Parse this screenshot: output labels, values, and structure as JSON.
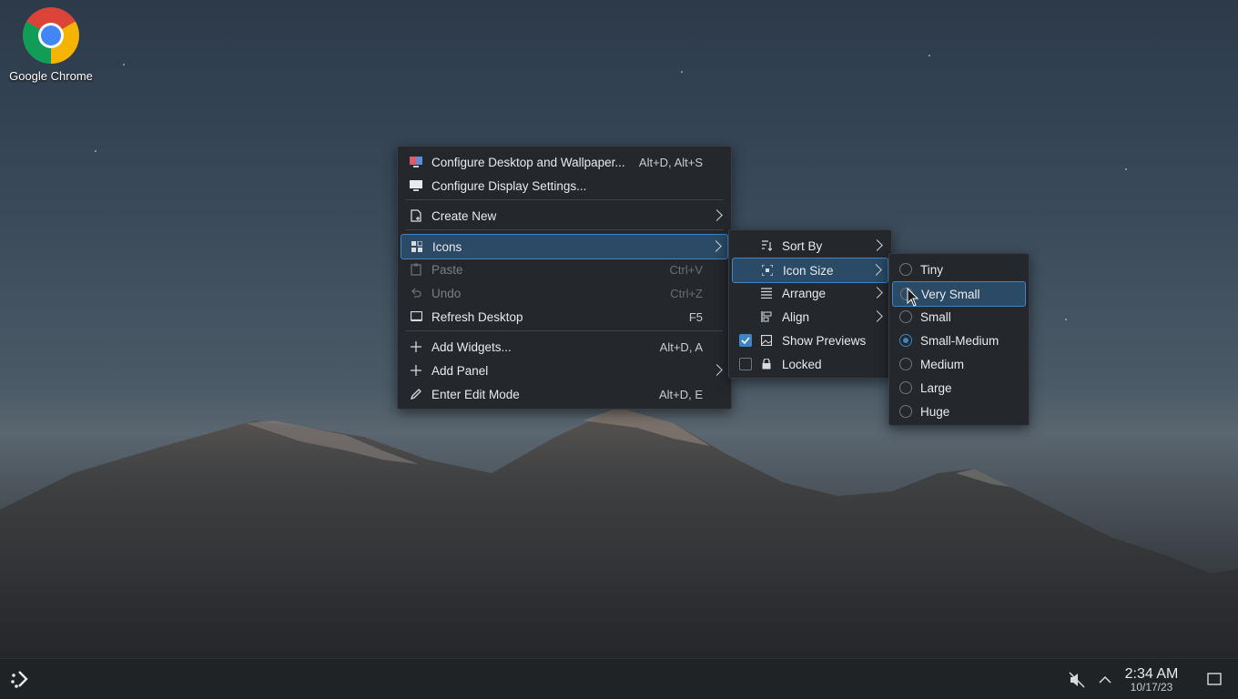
{
  "desktop": {
    "icons": [
      {
        "label": "Google Chrome",
        "icon": "chrome-icon"
      }
    ]
  },
  "main_menu": {
    "items": [
      {
        "label": "Configure Desktop and Wallpaper...",
        "shortcut": "Alt+D, Alt+S",
        "icon": "desktop-config-icon"
      },
      {
        "label": "Configure Display Settings...",
        "shortcut": "",
        "icon": "display-icon"
      },
      {
        "label": "Create New",
        "icon": "new-file-icon",
        "submenu": true
      },
      {
        "label": "Icons",
        "icon": "icons-grid-icon",
        "submenu": true,
        "highlighted": true
      },
      {
        "label": "Paste",
        "shortcut": "Ctrl+V",
        "icon": "paste-icon",
        "disabled": true
      },
      {
        "label": "Undo",
        "shortcut": "Ctrl+Z",
        "icon": "undo-icon",
        "disabled": true
      },
      {
        "label": "Refresh Desktop",
        "shortcut": "F5",
        "icon": "refresh-icon"
      },
      {
        "label": "Add Widgets...",
        "shortcut": "Alt+D, A",
        "icon": "plus-icon"
      },
      {
        "label": "Add Panel",
        "icon": "plus-icon",
        "submenu": true
      },
      {
        "label": "Enter Edit Mode",
        "shortcut": "Alt+D, E",
        "icon": "pencil-icon"
      }
    ]
  },
  "icons_menu": {
    "items": [
      {
        "label": "Sort By",
        "icon": "sort-icon",
        "submenu": true
      },
      {
        "label": "Icon Size",
        "icon": "icon-size-icon",
        "submenu": true,
        "highlighted": true
      },
      {
        "label": "Arrange",
        "icon": "arrange-icon",
        "submenu": true
      },
      {
        "label": "Align",
        "icon": "align-icon",
        "submenu": true
      },
      {
        "label": "Show Previews",
        "icon": "image-icon",
        "checked": true
      },
      {
        "label": "Locked",
        "icon": "lock-icon",
        "checked": false
      }
    ]
  },
  "size_menu": {
    "items": [
      {
        "label": "Tiny",
        "selected": false
      },
      {
        "label": "Very Small",
        "selected": false,
        "highlighted": true
      },
      {
        "label": "Small",
        "selected": false
      },
      {
        "label": "Small-Medium",
        "selected": true
      },
      {
        "label": "Medium",
        "selected": false
      },
      {
        "label": "Large",
        "selected": false
      },
      {
        "label": "Huge",
        "selected": false
      }
    ]
  },
  "taskbar": {
    "time": "2:34 AM",
    "date": "10/17/23",
    "accent": "#3d85c6"
  }
}
